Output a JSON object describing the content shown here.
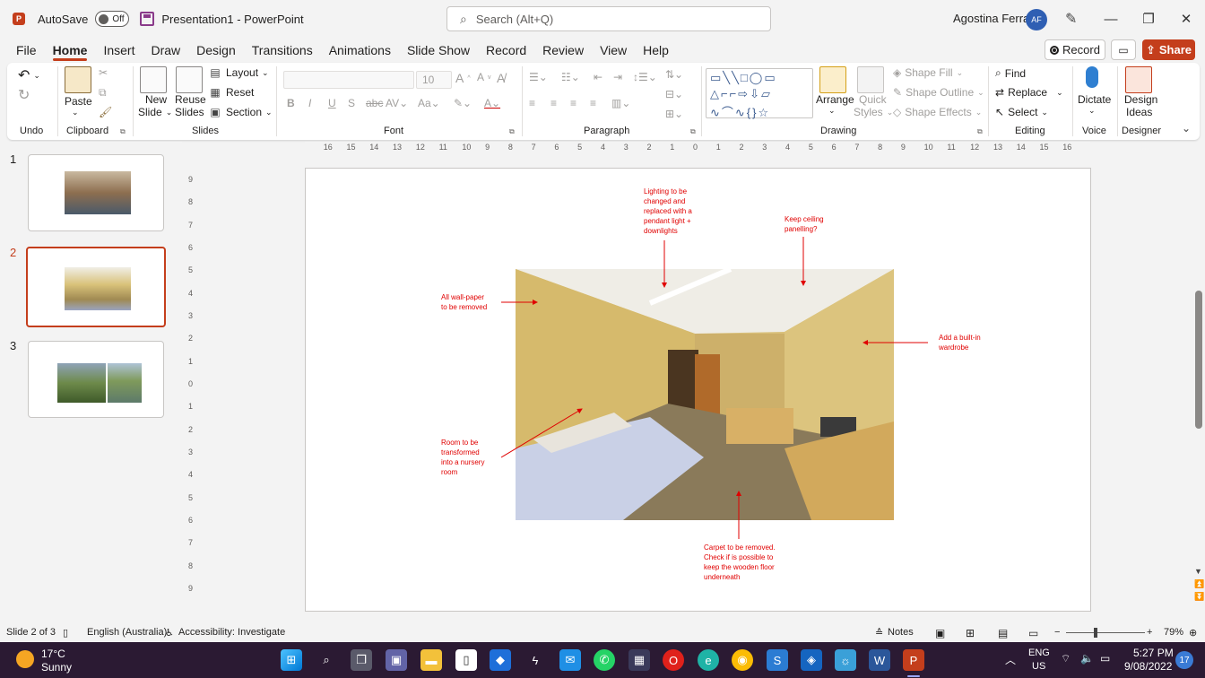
{
  "titlebar": {
    "autosave_label": "AutoSave",
    "autosave_state": "Off",
    "document_title": "Presentation1  -  PowerPoint",
    "search_placeholder": "Search (Alt+Q)",
    "user_name": "Agostina Ferrari",
    "user_initials": "AF"
  },
  "tabs": [
    "File",
    "Home",
    "Insert",
    "Draw",
    "Design",
    "Transitions",
    "Animations",
    "Slide Show",
    "Record",
    "Review",
    "View",
    "Help"
  ],
  "tab_actions": {
    "record": "Record",
    "share": "Share"
  },
  "ribbon": {
    "groups": {
      "undo": "Undo",
      "clipboard": "Clipboard",
      "slides": "Slides",
      "font": "Font",
      "paragraph": "Paragraph",
      "drawing": "Drawing",
      "editing": "Editing",
      "voice": "Voice",
      "designer": "Designer"
    },
    "paste": "Paste",
    "new_slide_1": "New",
    "new_slide_2": "Slide",
    "reuse_slides_1": "Reuse",
    "reuse_slides_2": "Slides",
    "layout": "Layout",
    "reset": "Reset",
    "section": "Section",
    "font_size": "10",
    "arrange": "Arrange",
    "quick_styles_1": "Quick",
    "quick_styles_2": "Styles",
    "shape_fill": "Shape Fill",
    "shape_outline": "Shape Outline",
    "shape_effects": "Shape Effects",
    "find": "Find",
    "replace": "Replace",
    "select": "Select",
    "dictate": "Dictate",
    "design_ideas_1": "Design",
    "design_ideas_2": "Ideas"
  },
  "slides": {
    "numbers": [
      "1",
      "2",
      "3"
    ],
    "active_index": 2
  },
  "slide_notes": {
    "lighting": [
      "Lighting to be",
      "changed and",
      "replaced with a",
      "pendant light +",
      "downlights"
    ],
    "ceiling": [
      "Keep ceiling",
      "panelling?"
    ],
    "wallpaper": [
      "All wall-paper",
      "to be removed"
    ],
    "wardrobe": [
      "Add a built-in",
      "wardrobe"
    ],
    "nursery": [
      "Room to be",
      "transformed",
      "into a nursery",
      "room"
    ],
    "carpet": [
      "Carpet to be removed.",
      "Check if is possible to",
      "keep the wooden floor",
      "underneath"
    ]
  },
  "ruler_h": [
    "16",
    "15",
    "14",
    "13",
    "12",
    "11",
    "10",
    "9",
    "8",
    "7",
    "6",
    "5",
    "4",
    "3",
    "2",
    "1",
    "0",
    "1",
    "2",
    "3",
    "4",
    "5",
    "6",
    "7",
    "8",
    "9",
    "10",
    "11",
    "12",
    "13",
    "14",
    "15",
    "16"
  ],
  "ruler_v": [
    "9",
    "8",
    "7",
    "6",
    "5",
    "4",
    "3",
    "2",
    "1",
    "0",
    "1",
    "2",
    "3",
    "4",
    "5",
    "6",
    "7",
    "8",
    "9"
  ],
  "statusbar": {
    "slide_counter": "Slide 2 of 3",
    "language": "English (Australia)",
    "accessibility": "Accessibility: Investigate",
    "notes": "Notes",
    "zoom": "79%"
  },
  "taskbar": {
    "temperature": "17°C",
    "weather": "Sunny",
    "lang_1": "ENG",
    "lang_2": "US",
    "time": "5:27 PM",
    "date": "9/08/2022",
    "notification_count": "17"
  },
  "colors": {
    "accent": "#c43e1c",
    "note_red": "#e00000",
    "taskbar": "#2b1a33"
  }
}
